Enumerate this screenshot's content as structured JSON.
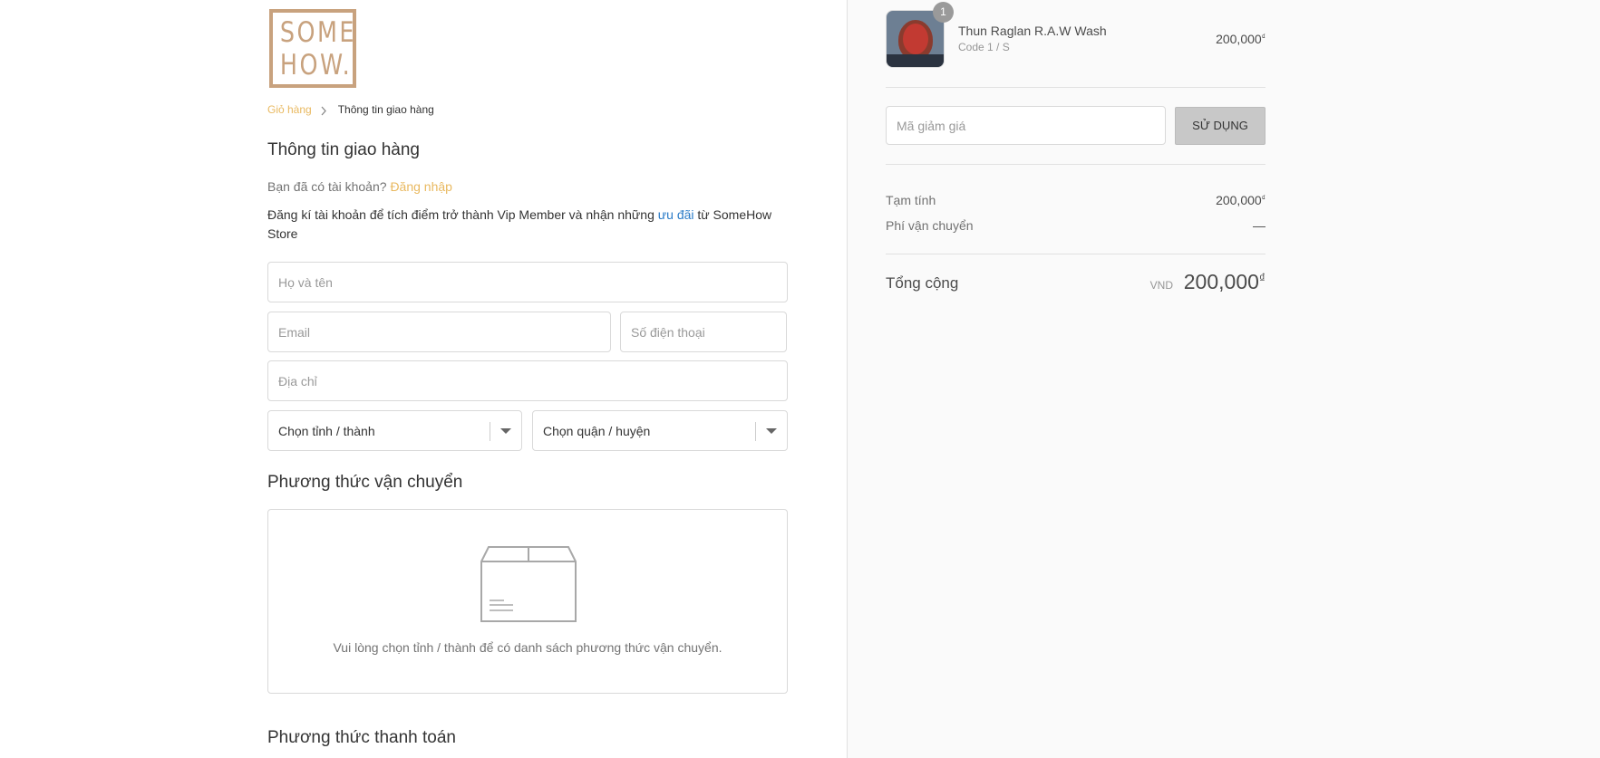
{
  "brand": {
    "logo_text": "SOME\nHOW."
  },
  "breadcrumb": {
    "cart": "Giỏ hàng",
    "current": "Thông tin giao hàng"
  },
  "shipping_info": {
    "title": "Thông tin giao hàng",
    "account_question": "Bạn đã có tài khoản?",
    "login_link": "Đăng nhập",
    "promo_before": "Đăng kí tài khoản để tích điểm trở thành Vip Member và nhận những ",
    "promo_link": "ưu đãi",
    "promo_after": " từ SomeHow Store",
    "fields": {
      "name_placeholder": "Họ và tên",
      "email_placeholder": "Email",
      "phone_placeholder": "Số điện thoại",
      "address_placeholder": "Địa chỉ"
    },
    "province_select": "Chọn tỉnh / thành",
    "district_select": "Chọn quận / huyện"
  },
  "shipping_method": {
    "title": "Phương thức vận chuyển",
    "empty_message": "Vui lòng chọn tỉnh / thành để có danh sách phương thức vận chuyển."
  },
  "payment_method": {
    "title": "Phương thức thanh toán"
  },
  "order_summary": {
    "product": {
      "name": "Thun Raglan R.A.W Wash",
      "variant": "Code 1 / S",
      "price": "200,000",
      "quantity": "1"
    },
    "discount": {
      "placeholder": "Mã giảm giá",
      "button": "SỬ DỤNG"
    },
    "subtotal_label": "Tạm tính",
    "subtotal_value": "200,000",
    "shipping_label": "Phí vận chuyển",
    "shipping_value": "—",
    "total_label": "Tổng cộng",
    "currency": "VND",
    "total_value": "200,000",
    "currency_symbol": "₫"
  },
  "colors": {
    "accent": "#e9b960",
    "logo": "#c8a27e",
    "link_blue": "#2a7bc7"
  }
}
